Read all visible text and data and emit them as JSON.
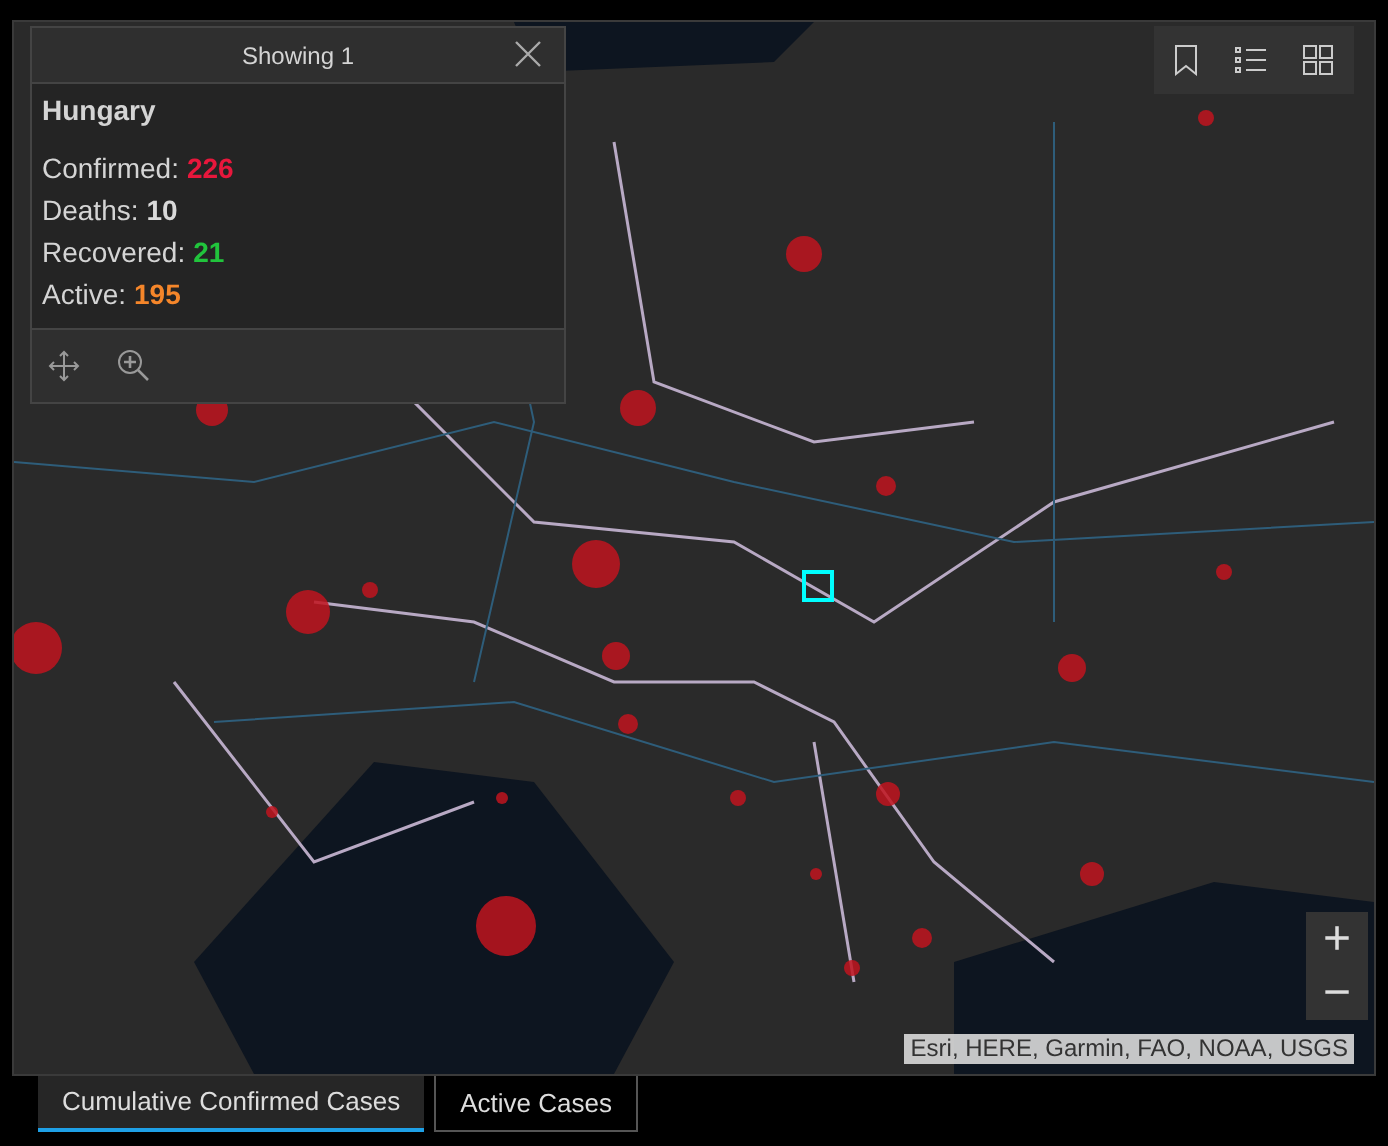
{
  "popup": {
    "header": "Showing 1",
    "title": "Hungary",
    "fields": [
      {
        "label": "Confirmed:",
        "value": "226",
        "color": "#e8173c"
      },
      {
        "label": "Deaths:",
        "value": "10",
        "color": "#d9d9d9"
      },
      {
        "label": "Recovered:",
        "value": "21",
        "color": "#21c43c"
      },
      {
        "label": "Active:",
        "value": "195",
        "color": "#f5862a"
      }
    ]
  },
  "zoom_controls": [
    "+",
    "−"
  ],
  "attribution": "Esri, HERE, Garmin, FAO, NOAA, USGS",
  "tabs": [
    {
      "label": "Cumulative Confirmed Cases",
      "selected": true
    },
    {
      "label": "Active Cases",
      "selected": false
    }
  ]
}
